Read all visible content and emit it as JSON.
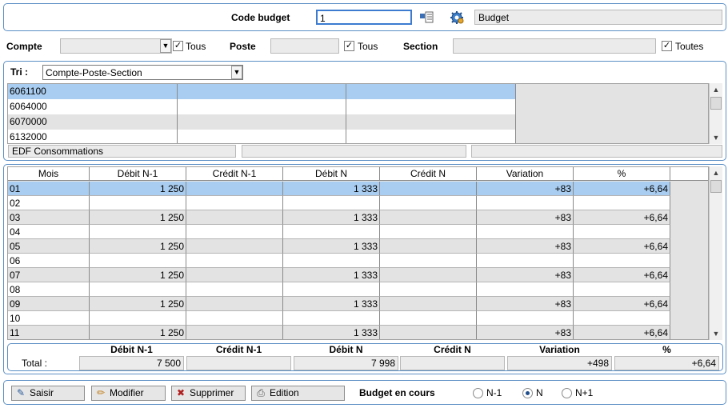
{
  "header": {
    "code_budget_label": "Code budget",
    "code_budget_value": "1",
    "budget_name": "Budget"
  },
  "filters": {
    "compte_label": "Compte",
    "compte_value": "",
    "compte_tous": "Tous",
    "poste_label": "Poste",
    "poste_value": "",
    "poste_tous": "Tous",
    "section_label": "Section",
    "section_value": "",
    "section_toutes": "Toutes"
  },
  "tri": {
    "label": "Tri :",
    "value": "Compte-Poste-Section"
  },
  "list": {
    "rows": [
      {
        "col1": "6061100",
        "col2": "",
        "col3": ""
      },
      {
        "col1": "6064000",
        "col2": "",
        "col3": ""
      },
      {
        "col1": "6070000",
        "col2": "",
        "col3": ""
      },
      {
        "col1": "6132000",
        "col2": "",
        "col3": ""
      }
    ],
    "desc1": "EDF Consommations",
    "desc2": "",
    "desc3": ""
  },
  "grid": {
    "columns": [
      "Mois",
      "Débit N-1",
      "Crédit N-1",
      "Débit N",
      "Crédit N",
      "Variation",
      "%"
    ],
    "rows": [
      {
        "mois": "01",
        "debit_n1": "1 250",
        "credit_n1": "",
        "debit_n": "1 333",
        "credit_n": "",
        "variation": "+83",
        "pct": "+6,64"
      },
      {
        "mois": "02",
        "debit_n1": "",
        "credit_n1": "",
        "debit_n": "",
        "credit_n": "",
        "variation": "",
        "pct": ""
      },
      {
        "mois": "03",
        "debit_n1": "1 250",
        "credit_n1": "",
        "debit_n": "1 333",
        "credit_n": "",
        "variation": "+83",
        "pct": "+6,64"
      },
      {
        "mois": "04",
        "debit_n1": "",
        "credit_n1": "",
        "debit_n": "",
        "credit_n": "",
        "variation": "",
        "pct": ""
      },
      {
        "mois": "05",
        "debit_n1": "1 250",
        "credit_n1": "",
        "debit_n": "1 333",
        "credit_n": "",
        "variation": "+83",
        "pct": "+6,64"
      },
      {
        "mois": "06",
        "debit_n1": "",
        "credit_n1": "",
        "debit_n": "",
        "credit_n": "",
        "variation": "",
        "pct": ""
      },
      {
        "mois": "07",
        "debit_n1": "1 250",
        "credit_n1": "",
        "debit_n": "1 333",
        "credit_n": "",
        "variation": "+83",
        "pct": "+6,64"
      },
      {
        "mois": "08",
        "debit_n1": "",
        "credit_n1": "",
        "debit_n": "",
        "credit_n": "",
        "variation": "",
        "pct": ""
      },
      {
        "mois": "09",
        "debit_n1": "1 250",
        "credit_n1": "",
        "debit_n": "1 333",
        "credit_n": "",
        "variation": "+83",
        "pct": "+6,64"
      },
      {
        "mois": "10",
        "debit_n1": "",
        "credit_n1": "",
        "debit_n": "",
        "credit_n": "",
        "variation": "",
        "pct": ""
      },
      {
        "mois": "11",
        "debit_n1": "1 250",
        "credit_n1": "",
        "debit_n": "1 333",
        "credit_n": "",
        "variation": "+83",
        "pct": "+6,64"
      }
    ]
  },
  "totals": {
    "label": "Total :",
    "headers": [
      "Débit N-1",
      "Crédit N-1",
      "Débit N",
      "Crédit N",
      "Variation",
      "%"
    ],
    "debit_n1": "7 500",
    "credit_n1": "",
    "debit_n": "7 998",
    "credit_n": "",
    "variation": "+498",
    "pct": "+6,64"
  },
  "footer": {
    "saisir": "Saisir",
    "modifier": "Modifier",
    "supprimer": "Supprimer",
    "edition": "Edition",
    "budget_en_cours": "Budget en cours",
    "radio_n1": "N-1",
    "radio_n": "N",
    "radio_np1": "N+1",
    "selected": "N"
  },
  "colors": {
    "selection": "#a9cdf0",
    "panel_border": "#5b8fc4",
    "alt_row": "#e3e3e3"
  }
}
